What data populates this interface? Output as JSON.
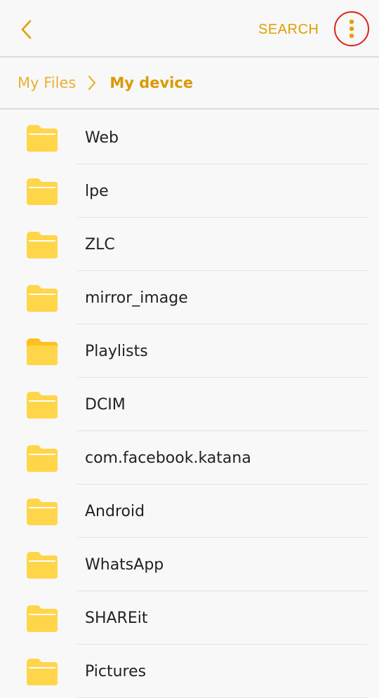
{
  "header": {
    "search_label": "SEARCH",
    "icons": [
      "back-chevron-icon",
      "more-options-icon"
    ],
    "accent_color": "#e0a000",
    "highlight_color": "#e02020"
  },
  "breadcrumb": {
    "root": "My Files",
    "current": "My device"
  },
  "folders": [
    {
      "name": "Web"
    },
    {
      "name": "lpe"
    },
    {
      "name": "ZLC"
    },
    {
      "name": "mirror_image"
    },
    {
      "name": "Playlists"
    },
    {
      "name": "DCIM"
    },
    {
      "name": "com.facebook.katana"
    },
    {
      "name": "Android"
    },
    {
      "name": "WhatsApp"
    },
    {
      "name": "SHAREit"
    },
    {
      "name": "Pictures"
    }
  ],
  "folder_color": "#ffd54a"
}
